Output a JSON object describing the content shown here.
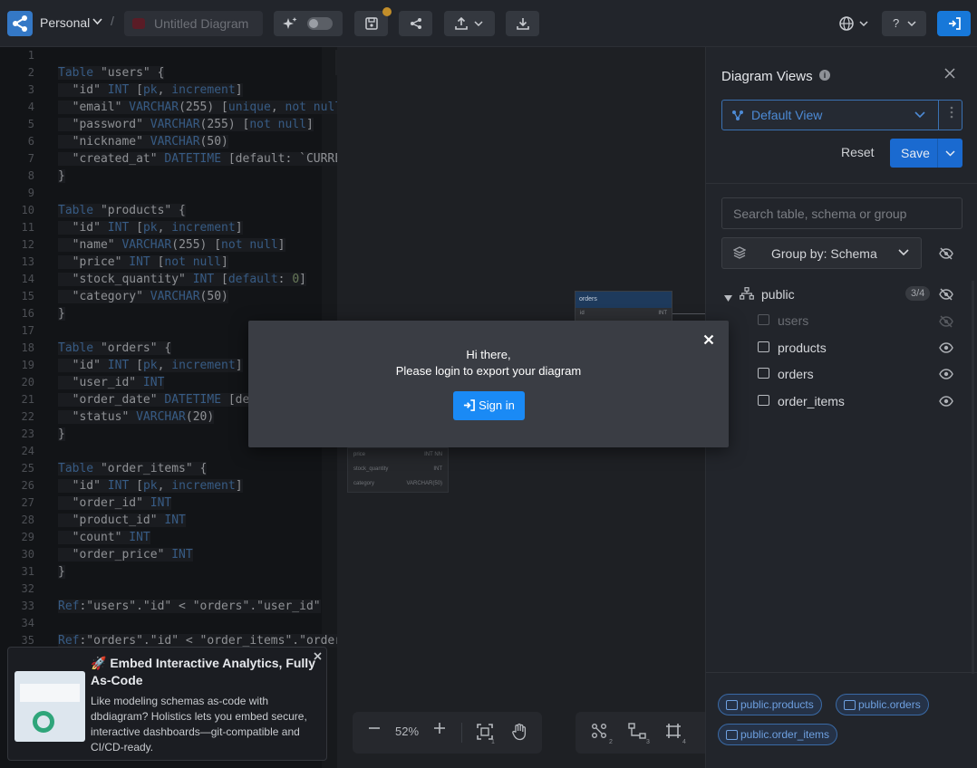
{
  "topbar": {
    "workspace": "Personal",
    "separator": "/",
    "diagram_title": "Untitled Diagram",
    "help_label": "?",
    "chevron": "⌄"
  },
  "editor": {
    "lines": [
      {
        "n": "1",
        "segments": []
      },
      {
        "n": "2",
        "segments": [
          [
            "kw",
            "Table"
          ],
          [
            "str",
            " \"users\" {"
          ]
        ]
      },
      {
        "n": "3",
        "segments": [
          [
            "str",
            "  \"id\" "
          ],
          [
            "typ",
            "INT"
          ],
          [
            "str",
            " ["
          ],
          [
            "kw",
            "pk"
          ],
          [
            "str",
            ", "
          ],
          [
            "kw",
            "increment"
          ],
          [
            "str",
            "]"
          ]
        ]
      },
      {
        "n": "4",
        "segments": [
          [
            "str",
            "  \"email\" "
          ],
          [
            "typ",
            "VARCHAR"
          ],
          [
            "str",
            "(255) ["
          ],
          [
            "kw",
            "unique"
          ],
          [
            "str",
            ", "
          ],
          [
            "kw",
            "not null"
          ]
        ]
      },
      {
        "n": "5",
        "segments": [
          [
            "str",
            "  \"password\" "
          ],
          [
            "typ",
            "VARCHAR"
          ],
          [
            "str",
            "(255) ["
          ],
          [
            "kw",
            "not null"
          ],
          [
            "str",
            "]"
          ]
        ]
      },
      {
        "n": "6",
        "segments": [
          [
            "str",
            "  \"nickname\" "
          ],
          [
            "typ",
            "VARCHAR"
          ],
          [
            "str",
            "(50)"
          ]
        ]
      },
      {
        "n": "7",
        "segments": [
          [
            "str",
            "  \"created_at\" "
          ],
          [
            "typ",
            "DATETIME"
          ],
          [
            "str",
            " [default: `CURRE"
          ]
        ]
      },
      {
        "n": "8",
        "segments": [
          [
            "str",
            "}"
          ]
        ]
      },
      {
        "n": "9",
        "segments": []
      },
      {
        "n": "10",
        "segments": [
          [
            "kw",
            "Table"
          ],
          [
            "str",
            " \"products\" {"
          ]
        ]
      },
      {
        "n": "11",
        "segments": [
          [
            "str",
            "  \"id\" "
          ],
          [
            "typ",
            "INT"
          ],
          [
            "str",
            " ["
          ],
          [
            "kw",
            "pk"
          ],
          [
            "str",
            ", "
          ],
          [
            "kw",
            "increment"
          ],
          [
            "str",
            "]"
          ]
        ]
      },
      {
        "n": "12",
        "segments": [
          [
            "str",
            "  \"name\" "
          ],
          [
            "typ",
            "VARCHAR"
          ],
          [
            "str",
            "(255) ["
          ],
          [
            "kw",
            "not null"
          ],
          [
            "str",
            "]"
          ]
        ]
      },
      {
        "n": "13",
        "segments": [
          [
            "str",
            "  \"price\" "
          ],
          [
            "typ",
            "INT"
          ],
          [
            "str",
            " ["
          ],
          [
            "kw",
            "not null"
          ],
          [
            "str",
            "]"
          ]
        ]
      },
      {
        "n": "14",
        "segments": [
          [
            "str",
            "  \"stock_quantity\" "
          ],
          [
            "typ",
            "INT"
          ],
          [
            "str",
            " ["
          ],
          [
            "kw",
            "default"
          ],
          [
            "str",
            ": "
          ],
          [
            "num",
            "0"
          ],
          [
            "str",
            "]"
          ]
        ]
      },
      {
        "n": "15",
        "segments": [
          [
            "str",
            "  \"category\" "
          ],
          [
            "typ",
            "VARCHAR"
          ],
          [
            "str",
            "(50)"
          ]
        ]
      },
      {
        "n": "16",
        "segments": [
          [
            "str",
            "}"
          ]
        ]
      },
      {
        "n": "17",
        "segments": []
      },
      {
        "n": "18",
        "segments": [
          [
            "kw",
            "Table"
          ],
          [
            "str",
            " \"orders\" {"
          ]
        ]
      },
      {
        "n": "19",
        "segments": [
          [
            "str",
            "  \"id\" "
          ],
          [
            "typ",
            "INT"
          ],
          [
            "str",
            " ["
          ],
          [
            "kw",
            "pk"
          ],
          [
            "str",
            ", "
          ],
          [
            "kw",
            "increment"
          ],
          [
            "str",
            "]"
          ]
        ]
      },
      {
        "n": "20",
        "segments": [
          [
            "str",
            "  \"user_id\" "
          ],
          [
            "typ",
            "INT"
          ]
        ]
      },
      {
        "n": "21",
        "segments": [
          [
            "str",
            "  \"order_date\" "
          ],
          [
            "typ",
            "DATETIME"
          ],
          [
            "str",
            " [def"
          ]
        ]
      },
      {
        "n": "22",
        "segments": [
          [
            "str",
            "  \"status\" "
          ],
          [
            "typ",
            "VARCHAR"
          ],
          [
            "str",
            "(20)"
          ]
        ]
      },
      {
        "n": "23",
        "segments": [
          [
            "str",
            "}"
          ]
        ]
      },
      {
        "n": "24",
        "segments": []
      },
      {
        "n": "25",
        "segments": [
          [
            "kw",
            "Table"
          ],
          [
            "str",
            " \"order_items\" {"
          ]
        ]
      },
      {
        "n": "26",
        "segments": [
          [
            "str",
            "  \"id\" "
          ],
          [
            "typ",
            "INT"
          ],
          [
            "str",
            " ["
          ],
          [
            "kw",
            "pk"
          ],
          [
            "str",
            ", "
          ],
          [
            "kw",
            "increment"
          ],
          [
            "str",
            "]"
          ]
        ]
      },
      {
        "n": "27",
        "segments": [
          [
            "str",
            "  \"order_id\" "
          ],
          [
            "typ",
            "INT"
          ]
        ]
      },
      {
        "n": "28",
        "segments": [
          [
            "str",
            "  \"product_id\" "
          ],
          [
            "typ",
            "INT"
          ]
        ]
      },
      {
        "n": "29",
        "segments": [
          [
            "str",
            "  \"count\" "
          ],
          [
            "typ",
            "INT"
          ]
        ]
      },
      {
        "n": "30",
        "segments": [
          [
            "str",
            "  \"order_price\" "
          ],
          [
            "typ",
            "INT"
          ]
        ]
      },
      {
        "n": "31",
        "segments": [
          [
            "str",
            "}"
          ]
        ]
      },
      {
        "n": "32",
        "segments": []
      },
      {
        "n": "33",
        "segments": [
          [
            "kw",
            "Ref"
          ],
          [
            "str",
            ":\"users\".\"id\" < \"orders\".\"user_id\""
          ]
        ]
      },
      {
        "n": "34",
        "segments": []
      },
      {
        "n": "35",
        "segments": [
          [
            "kw",
            "Ref"
          ],
          [
            "str",
            ":\"orders\".\"id\" < \"order_items\".\"order"
          ]
        ]
      }
    ]
  },
  "canvas": {
    "mini_table_title": "orders",
    "mini_row_name": "id",
    "mini_row_type": "INT",
    "mini_rows2": [
      {
        "name": "price",
        "type": "INT  NN"
      },
      {
        "name": "stock_quantity",
        "type": "INT"
      },
      {
        "name": "category",
        "type": "VARCHAR(50)"
      }
    ],
    "zoom_level": "52%",
    "shortcut_1": "1",
    "shortcut_2": "2",
    "shortcut_3": "3",
    "shortcut_4": "4"
  },
  "panel": {
    "title": "Diagram Views",
    "info": "i",
    "view_name": "Default View",
    "reset_label": "Reset",
    "save_label": "Save",
    "search_placeholder": "Search table, schema or group",
    "group_by_label": "Group by: Schema",
    "schema": {
      "name": "public",
      "count": "3/4"
    },
    "tables": [
      {
        "name": "users",
        "hidden": true
      },
      {
        "name": "products",
        "hidden": false
      },
      {
        "name": "orders",
        "hidden": false
      },
      {
        "name": "order_items",
        "hidden": false
      }
    ],
    "chips": [
      "public.products",
      "public.orders",
      "public.order_items"
    ]
  },
  "modal": {
    "line1": "Hi there,",
    "line2": "Please login to export your diagram",
    "signin_label": "Sign in"
  },
  "ad": {
    "title": "🚀 Embed Interactive Analytics, Fully As-Code",
    "body": "Like modeling schemas as-code with dbdiagram? Holistics lets you embed secure, interactive dashboards—git-compatible and CI/CD-ready."
  },
  "colors": {
    "accent": "#1a8af5",
    "save": "#1a6ad0",
    "chip": "#6ea0e0"
  }
}
